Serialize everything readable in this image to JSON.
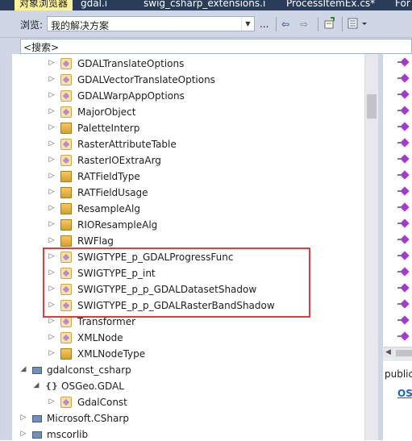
{
  "tabs": [
    {
      "label": "对象浏览器",
      "active": true
    },
    {
      "label": "gdal.i",
      "active": false
    },
    {
      "label": "swig_csharp_extensions.i",
      "active": false
    },
    {
      "label": "ProcessItemEx.cs*",
      "active": false
    },
    {
      "label": "For",
      "active": false
    }
  ],
  "toolbar": {
    "browse_label": "浏览:",
    "scope_value": "我的解决方案",
    "more_label": "..."
  },
  "search": {
    "text": "<搜索>"
  },
  "tree": {
    "items": [
      {
        "label": "GDALTranslateOptions",
        "icon": "class-icon"
      },
      {
        "label": "GDALVectorTranslateOptions",
        "icon": "class-icon"
      },
      {
        "label": "GDALWarpAppOptions",
        "icon": "class-icon"
      },
      {
        "label": "MajorObject",
        "icon": "class-icon"
      },
      {
        "label": "PaletteInterp",
        "icon": "enum-icon"
      },
      {
        "label": "RasterAttributeTable",
        "icon": "class-icon"
      },
      {
        "label": "RasterIOExtraArg",
        "icon": "class-icon"
      },
      {
        "label": "RATFieldType",
        "icon": "enum-icon"
      },
      {
        "label": "RATFieldUsage",
        "icon": "enum-icon"
      },
      {
        "label": "ResampleAlg",
        "icon": "enum-icon"
      },
      {
        "label": "RIOResampleAlg",
        "icon": "enum-icon"
      },
      {
        "label": "RWFlag",
        "icon": "enum-icon"
      },
      {
        "label": "SWIGTYPE_p_GDALProgressFunc",
        "icon": "class-icon"
      },
      {
        "label": "SWIGTYPE_p_int",
        "icon": "class-icon"
      },
      {
        "label": "SWIGTYPE_p_p_GDALDatasetShadow",
        "icon": "class-icon"
      },
      {
        "label": "SWIGTYPE_p_p_GDALRasterBandShadow",
        "icon": "class-icon"
      },
      {
        "label": "Transformer",
        "icon": "class-icon"
      },
      {
        "label": "XMLNode",
        "icon": "class-icon"
      },
      {
        "label": "XMLNodeType",
        "icon": "enum-icon"
      }
    ],
    "assembly_gdalconst": "gdalconst_csharp",
    "namespace_osgeo": "OSGeo.GDAL",
    "class_gdalconst": "GdalConst",
    "assembly_microsoft": "Microsoft.CSharp",
    "assembly_mscorlib": "mscorlib"
  },
  "description": {
    "keyword": "public",
    "link": "OS"
  }
}
